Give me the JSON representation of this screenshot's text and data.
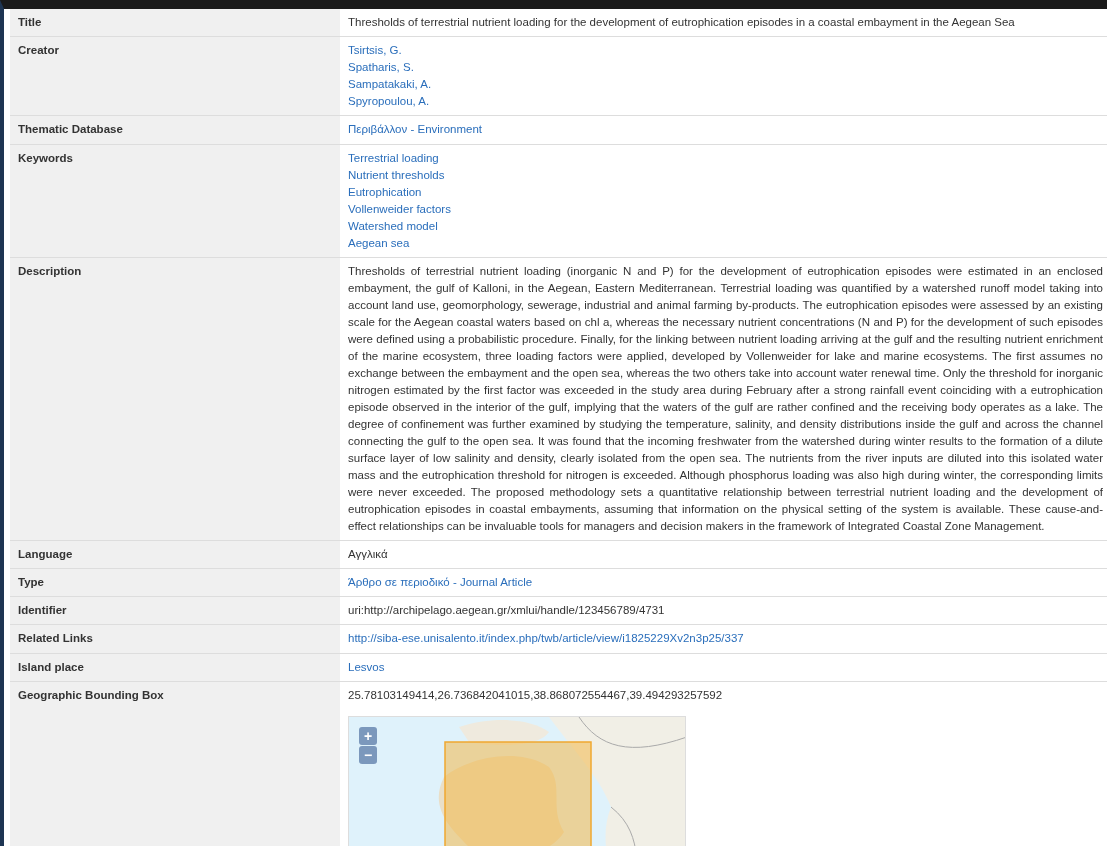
{
  "rows": [
    {
      "label": "Title",
      "kind": "text",
      "values": [
        "Thresholds of terrestrial nutrient loading for the development of eutrophication episodes in a coastal embayment in the Aegean Sea"
      ]
    },
    {
      "label": "Creator",
      "kind": "links",
      "values": [
        "Tsirtsis, G.",
        "Spatharis, S.",
        "Sampatakaki, A.",
        "Spyropoulou, A."
      ]
    },
    {
      "label": "Thematic Database",
      "kind": "links",
      "values": [
        "Περιβάλλον - Environment"
      ]
    },
    {
      "label": "Keywords",
      "kind": "links",
      "values": [
        "Terrestrial loading",
        "Nutrient thresholds",
        "Eutrophication",
        "Vollenweider factors",
        "Watershed model",
        "Aegean sea"
      ]
    },
    {
      "label": "Description",
      "kind": "paragraph",
      "values": [
        "Thresholds of terrestrial nutrient loading (inorganic N and P) for the development of eutrophication episodes were estimated in an enclosed embayment, the gulf of Kalloni, in the Aegean, Eastern Mediterranean. Terrestrial loading was quantified by a watershed runoff model taking into account land use, geomorphology, sewerage, industrial and animal farming by-products. The eutrophication episodes were assessed by an existing scale for the Aegean coastal waters based on chl a, whereas the necessary nutrient concentrations (N and P) for the development of such episodes were defined using a probabilistic procedure. Finally, for the linking between nutrient loading arriving at the gulf and the resulting nutrient enrichment of the marine ecosystem, three loading factors were applied, developed by Vollenweider for lake and marine ecosystems. The first assumes no exchange between the embayment and the open sea, whereas the two others take into account water renewal time. Only the threshold for inorganic nitrogen estimated by the first factor was exceeded in the study area during February after a strong rainfall event coinciding with a eutrophication episode observed in the interior of the gulf, implying that the waters of the gulf are rather confined and the receiving body operates as a lake. The degree of confinement was further examined by studying the temperature, salinity, and density distributions inside the gulf and across the channel connecting the gulf to the open sea. It was found that the incoming freshwater from the watershed during winter results to the formation of a dilute surface layer of low salinity and density, clearly isolated from the open sea. The nutrients from the river inputs are diluted into this isolated water mass and the eutrophication threshold for nitrogen is exceeded. Although phosphorus loading was also high during winter, the corresponding limits were never exceeded. The proposed methodology sets a quantitative relationship between terrestrial nutrient loading and the development of eutrophication episodes in coastal embayments, assuming that information on the physical setting of the system is available. These cause-and-effect relationships can be invaluable tools for managers and decision makers in the framework of Integrated Coastal Zone Management."
      ]
    },
    {
      "label": "Language",
      "kind": "text",
      "values": [
        "Αγγλικά"
      ]
    },
    {
      "label": "Type",
      "kind": "links",
      "values": [
        "Άρθρο σε περιοδικό - Journal Article"
      ]
    },
    {
      "label": "Identifier",
      "kind": "text",
      "values": [
        "uri:http://archipelago.aegean.gr/xmlui/handle/123456789/4731"
      ]
    },
    {
      "label": "Related Links",
      "kind": "links",
      "values": [
        "http://siba-ese.unisalento.it/index.php/twb/article/view/i1825229Xv2n3p25/337"
      ]
    },
    {
      "label": "Island place",
      "kind": "links",
      "values": [
        "Lesvos"
      ]
    },
    {
      "label": "Geographic Bounding Box",
      "kind": "map",
      "values": [
        "25.78103149414,26.736842041015,38.868072554467,39.494293257592"
      ],
      "zoom_buttons": [
        "+",
        "−"
      ]
    }
  ]
}
